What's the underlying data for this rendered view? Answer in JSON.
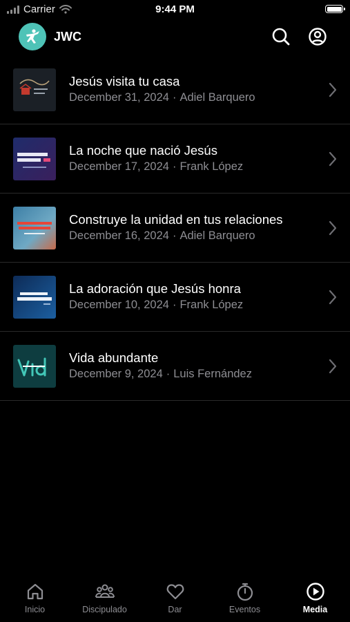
{
  "status_bar": {
    "carrier": "Carrier",
    "time": "9:44 PM",
    "battery_level": 1.0
  },
  "header": {
    "brand": "JWC",
    "logo_icon": "jwc-logo-icon",
    "search_icon": "search-icon",
    "profile_icon": "profile-icon"
  },
  "colors": {
    "accent": "#4ec3b7",
    "background": "#000000",
    "subtitle": "#8e8e93",
    "divider": "#2a2a2a"
  },
  "media_items": [
    {
      "title": "Jesús visita tu casa",
      "date": "December 31, 2024",
      "speaker": "Adiel Barquero"
    },
    {
      "title": "La noche que nació Jesús",
      "date": "December 17, 2024",
      "speaker": "Frank López"
    },
    {
      "title": "Construye la unidad en tus relaciones",
      "date": "December 16, 2024",
      "speaker": "Adiel Barquero"
    },
    {
      "title": "La adoración que Jesús honra",
      "date": "December 10, 2024",
      "speaker": "Frank López"
    },
    {
      "title": "Vida abundante",
      "date": "December 9, 2024",
      "speaker": "Luis Fernández"
    }
  ],
  "meta_separator": "·",
  "tabs": [
    {
      "label": "Inicio",
      "icon": "home-icon",
      "active": false
    },
    {
      "label": "Discipulado",
      "icon": "group-icon",
      "active": false
    },
    {
      "label": "Dar",
      "icon": "heart-icon",
      "active": false
    },
    {
      "label": "Eventos",
      "icon": "stopwatch-icon",
      "active": false
    },
    {
      "label": "Media",
      "icon": "play-circle-icon",
      "active": true
    }
  ]
}
